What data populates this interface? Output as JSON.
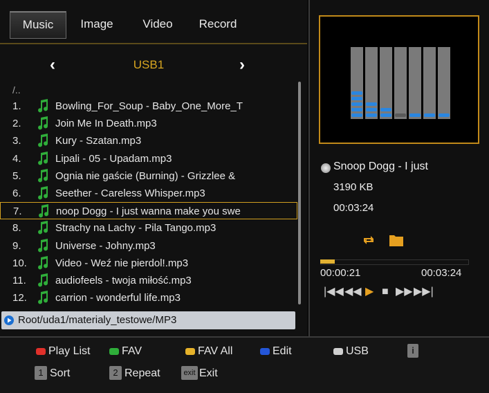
{
  "tabs": [
    {
      "label": "Music",
      "active": true
    },
    {
      "label": "Image"
    },
    {
      "label": "Video"
    },
    {
      "label": "Record"
    }
  ],
  "browser": {
    "device_title": "USB1",
    "parent_dir": "/..",
    "files": [
      {
        "num": "1.",
        "name": "Bowling_For_Soup - Baby_One_More_T"
      },
      {
        "num": "2.",
        "name": "Join Me In Death.mp3"
      },
      {
        "num": "3.",
        "name": "Kury - Szatan.mp3"
      },
      {
        "num": "4.",
        "name": "Lipali - 05 - Upadam.mp3"
      },
      {
        "num": "5.",
        "name": "Ognia nie gaście (Burning) - Grizzlee &"
      },
      {
        "num": "6.",
        "name": "Seether - Careless Whisper.mp3"
      },
      {
        "num": "7.",
        "name": "noop Dogg - I just wanna make you swe",
        "selected": true
      },
      {
        "num": "8.",
        "name": "Strachy na Lachy - Pila Tango.mp3"
      },
      {
        "num": "9.",
        "name": "Universe - Johny.mp3"
      },
      {
        "num": "10.",
        "name": "Video - Weź nie pierdol!.mp3"
      },
      {
        "num": "11.",
        "name": "audiofeels - twoja miłość.mp3"
      },
      {
        "num": "12.",
        "name": "carrion - wonderful life.mp3"
      }
    ],
    "path": "Root/uda1/materialy_testowe/MP3"
  },
  "now_playing": {
    "title": "Snoop Dogg - I just",
    "size": "3190 KB",
    "duration": "00:03:24",
    "current_time": "00:00:21",
    "total_time": "00:03:24",
    "progress_percent": 10
  },
  "equalizer_levels": [
    5,
    3,
    2,
    1,
    0,
    0,
    0
  ],
  "controls": {
    "prev": "|◀◀",
    "rewind": "◀◀",
    "play": "▶",
    "stop": "■",
    "forward": "▶▶",
    "next": "▶▶|"
  },
  "footer": {
    "play_list": "Play List",
    "fav": "FAV",
    "fav_all": "FAV All",
    "edit": "Edit",
    "usb": "USB",
    "info": "i",
    "sort_key": "1",
    "sort": "Sort",
    "repeat_key": "2",
    "repeat": "Repeat",
    "exit_key": "exit",
    "exit": "Exit"
  },
  "colors": {
    "accent": "#d7a520",
    "red_key": "#e0302a",
    "green_key": "#2fae3a",
    "yellow_key": "#e6b22a",
    "blue_key": "#2456d8",
    "white_key": "#cfcfcf"
  }
}
